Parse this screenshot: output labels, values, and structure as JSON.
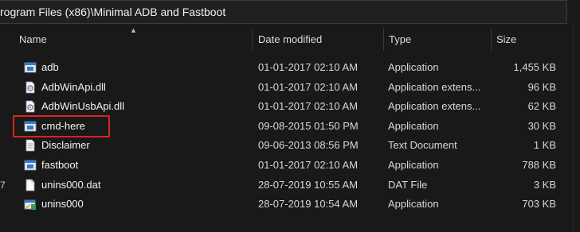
{
  "address_bar": {
    "path": "rogram Files (x86)\\Minimal ADB and Fastboot"
  },
  "nav_fragment": "7",
  "columns": {
    "name": "Name",
    "date_modified": "Date modified",
    "type": "Type",
    "size": "Size",
    "sorted_by": "name"
  },
  "files": [
    {
      "name": "adb",
      "date": "01-01-2017 02:10 AM",
      "type": "Application",
      "size": "1,455 KB",
      "icon": "application-icon"
    },
    {
      "name": "AdbWinApi.dll",
      "date": "01-01-2017 02:10 AM",
      "type": "Application extens...",
      "size": "96 KB",
      "icon": "dll-icon"
    },
    {
      "name": "AdbWinUsbApi.dll",
      "date": "01-01-2017 02:10 AM",
      "type": "Application extens...",
      "size": "62 KB",
      "icon": "dll-icon"
    },
    {
      "name": "cmd-here",
      "date": "09-08-2015 01:50 PM",
      "type": "Application",
      "size": "30 KB",
      "icon": "application-icon"
    },
    {
      "name": "Disclaimer",
      "date": "09-06-2013 08:56 PM",
      "type": "Text Document",
      "size": "1 KB",
      "icon": "text-document-icon"
    },
    {
      "name": "fastboot",
      "date": "01-01-2017 02:10 AM",
      "type": "Application",
      "size": "788 KB",
      "icon": "application-icon"
    },
    {
      "name": "unins000.dat",
      "date": "28-07-2019 10:55 AM",
      "type": "DAT File",
      "size": "3 KB",
      "icon": "dat-file-icon"
    },
    {
      "name": "unins000",
      "date": "28-07-2019 10:54 AM",
      "type": "Application",
      "size": "703 KB",
      "icon": "installer-icon"
    }
  ],
  "highlighted_file": "cmd-here",
  "colors": {
    "background": "#191919",
    "highlight": "#d9251d",
    "text": "#f2f2f2"
  }
}
